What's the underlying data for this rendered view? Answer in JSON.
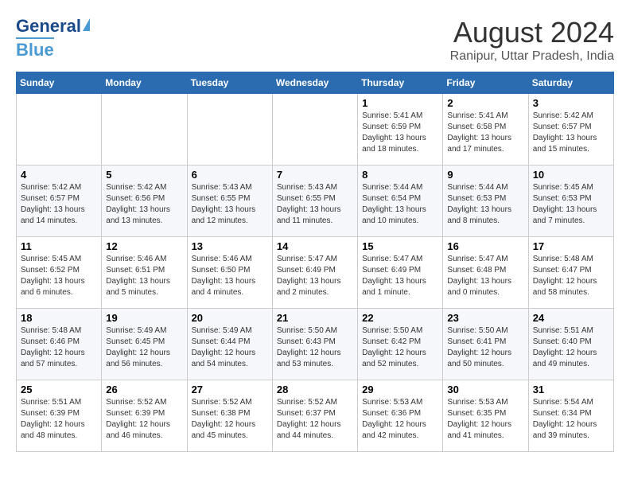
{
  "logo": {
    "line1": "General",
    "line2": "Blue"
  },
  "title": {
    "month": "August 2024",
    "location": "Ranipur, Uttar Pradesh, India"
  },
  "weekdays": [
    "Sunday",
    "Monday",
    "Tuesday",
    "Wednesday",
    "Thursday",
    "Friday",
    "Saturday"
  ],
  "weeks": [
    [
      {
        "day": "",
        "info": ""
      },
      {
        "day": "",
        "info": ""
      },
      {
        "day": "",
        "info": ""
      },
      {
        "day": "",
        "info": ""
      },
      {
        "day": "1",
        "info": "Sunrise: 5:41 AM\nSunset: 6:59 PM\nDaylight: 13 hours\nand 18 minutes."
      },
      {
        "day": "2",
        "info": "Sunrise: 5:41 AM\nSunset: 6:58 PM\nDaylight: 13 hours\nand 17 minutes."
      },
      {
        "day": "3",
        "info": "Sunrise: 5:42 AM\nSunset: 6:57 PM\nDaylight: 13 hours\nand 15 minutes."
      }
    ],
    [
      {
        "day": "4",
        "info": "Sunrise: 5:42 AM\nSunset: 6:57 PM\nDaylight: 13 hours\nand 14 minutes."
      },
      {
        "day": "5",
        "info": "Sunrise: 5:42 AM\nSunset: 6:56 PM\nDaylight: 13 hours\nand 13 minutes."
      },
      {
        "day": "6",
        "info": "Sunrise: 5:43 AM\nSunset: 6:55 PM\nDaylight: 13 hours\nand 12 minutes."
      },
      {
        "day": "7",
        "info": "Sunrise: 5:43 AM\nSunset: 6:55 PM\nDaylight: 13 hours\nand 11 minutes."
      },
      {
        "day": "8",
        "info": "Sunrise: 5:44 AM\nSunset: 6:54 PM\nDaylight: 13 hours\nand 10 minutes."
      },
      {
        "day": "9",
        "info": "Sunrise: 5:44 AM\nSunset: 6:53 PM\nDaylight: 13 hours\nand 8 minutes."
      },
      {
        "day": "10",
        "info": "Sunrise: 5:45 AM\nSunset: 6:53 PM\nDaylight: 13 hours\nand 7 minutes."
      }
    ],
    [
      {
        "day": "11",
        "info": "Sunrise: 5:45 AM\nSunset: 6:52 PM\nDaylight: 13 hours\nand 6 minutes."
      },
      {
        "day": "12",
        "info": "Sunrise: 5:46 AM\nSunset: 6:51 PM\nDaylight: 13 hours\nand 5 minutes."
      },
      {
        "day": "13",
        "info": "Sunrise: 5:46 AM\nSunset: 6:50 PM\nDaylight: 13 hours\nand 4 minutes."
      },
      {
        "day": "14",
        "info": "Sunrise: 5:47 AM\nSunset: 6:49 PM\nDaylight: 13 hours\nand 2 minutes."
      },
      {
        "day": "15",
        "info": "Sunrise: 5:47 AM\nSunset: 6:49 PM\nDaylight: 13 hours\nand 1 minute."
      },
      {
        "day": "16",
        "info": "Sunrise: 5:47 AM\nSunset: 6:48 PM\nDaylight: 13 hours\nand 0 minutes."
      },
      {
        "day": "17",
        "info": "Sunrise: 5:48 AM\nSunset: 6:47 PM\nDaylight: 12 hours\nand 58 minutes."
      }
    ],
    [
      {
        "day": "18",
        "info": "Sunrise: 5:48 AM\nSunset: 6:46 PM\nDaylight: 12 hours\nand 57 minutes."
      },
      {
        "day": "19",
        "info": "Sunrise: 5:49 AM\nSunset: 6:45 PM\nDaylight: 12 hours\nand 56 minutes."
      },
      {
        "day": "20",
        "info": "Sunrise: 5:49 AM\nSunset: 6:44 PM\nDaylight: 12 hours\nand 54 minutes."
      },
      {
        "day": "21",
        "info": "Sunrise: 5:50 AM\nSunset: 6:43 PM\nDaylight: 12 hours\nand 53 minutes."
      },
      {
        "day": "22",
        "info": "Sunrise: 5:50 AM\nSunset: 6:42 PM\nDaylight: 12 hours\nand 52 minutes."
      },
      {
        "day": "23",
        "info": "Sunrise: 5:50 AM\nSunset: 6:41 PM\nDaylight: 12 hours\nand 50 minutes."
      },
      {
        "day": "24",
        "info": "Sunrise: 5:51 AM\nSunset: 6:40 PM\nDaylight: 12 hours\nand 49 minutes."
      }
    ],
    [
      {
        "day": "25",
        "info": "Sunrise: 5:51 AM\nSunset: 6:39 PM\nDaylight: 12 hours\nand 48 minutes."
      },
      {
        "day": "26",
        "info": "Sunrise: 5:52 AM\nSunset: 6:39 PM\nDaylight: 12 hours\nand 46 minutes."
      },
      {
        "day": "27",
        "info": "Sunrise: 5:52 AM\nSunset: 6:38 PM\nDaylight: 12 hours\nand 45 minutes."
      },
      {
        "day": "28",
        "info": "Sunrise: 5:52 AM\nSunset: 6:37 PM\nDaylight: 12 hours\nand 44 minutes."
      },
      {
        "day": "29",
        "info": "Sunrise: 5:53 AM\nSunset: 6:36 PM\nDaylight: 12 hours\nand 42 minutes."
      },
      {
        "day": "30",
        "info": "Sunrise: 5:53 AM\nSunset: 6:35 PM\nDaylight: 12 hours\nand 41 minutes."
      },
      {
        "day": "31",
        "info": "Sunrise: 5:54 AM\nSunset: 6:34 PM\nDaylight: 12 hours\nand 39 minutes."
      }
    ]
  ]
}
